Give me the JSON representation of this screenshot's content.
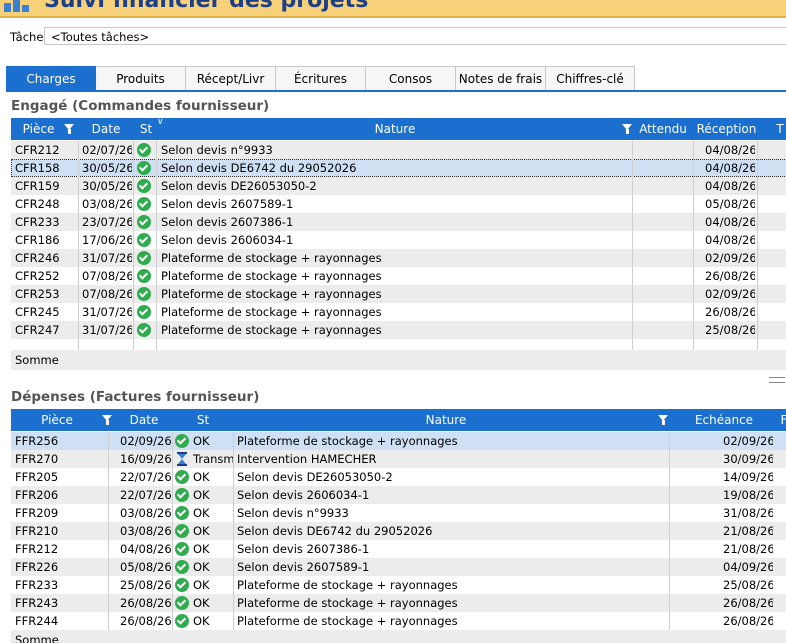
{
  "window": {
    "title": "Suivi financier des projets"
  },
  "filter": {
    "label": "Tâche",
    "value": "<Toutes tâches>"
  },
  "tabs": [
    "Charges",
    "Produits",
    "Récept/Livr",
    "Écritures",
    "Consos",
    "Notes de frais",
    "Chiffres-clé"
  ],
  "active_tab": "Charges",
  "colors": {
    "accent": "#1a6fcf",
    "title_bar": "#f7d179",
    "ok_icon": "#2eac4e",
    "selected_row": "#cfe0f5"
  },
  "engage": {
    "title": "Engagé (Commandes fournisseur)",
    "columns": {
      "piece": "Pièce",
      "date": "Date",
      "st": "St",
      "nature": "Nature",
      "attendu": "Attendu",
      "reception": "Réception",
      "extra": "T"
    },
    "rows": [
      {
        "piece": "CFR212",
        "date": "02/07/26",
        "status": "ok",
        "nature": "Selon devis n°9933",
        "attendu": "",
        "reception": "04/08/26"
      },
      {
        "piece": "CFR158",
        "date": "30/05/26",
        "status": "ok",
        "nature": "Selon devis DE6742 du 29052026",
        "attendu": "",
        "reception": "04/08/26"
      },
      {
        "piece": "CFR159",
        "date": "30/05/26",
        "status": "ok",
        "nature": "Selon devis DE26053050-2",
        "attendu": "",
        "reception": "04/08/26"
      },
      {
        "piece": "CFR248",
        "date": "03/08/26",
        "status": "ok",
        "nature": "Selon devis 2607589-1",
        "attendu": "",
        "reception": "05/08/26"
      },
      {
        "piece": "CFR233",
        "date": "23/07/26",
        "status": "ok",
        "nature": "Selon devis 2607386-1",
        "attendu": "",
        "reception": "04/08/26"
      },
      {
        "piece": "CFR186",
        "date": "17/06/26",
        "status": "ok",
        "nature": "Selon devis 2606034-1",
        "attendu": "",
        "reception": "04/08/26"
      },
      {
        "piece": "CFR246",
        "date": "31/07/26",
        "status": "ok",
        "nature": "Plateforme de stockage + rayonnages",
        "attendu": "",
        "reception": "02/09/26"
      },
      {
        "piece": "CFR252",
        "date": "07/08/26",
        "status": "ok",
        "nature": "Plateforme de stockage + rayonnages",
        "attendu": "",
        "reception": "26/08/26"
      },
      {
        "piece": "CFR253",
        "date": "07/08/26",
        "status": "ok",
        "nature": "Plateforme de stockage + rayonnages",
        "attendu": "",
        "reception": "02/09/26"
      },
      {
        "piece": "CFR245",
        "date": "31/07/26",
        "status": "ok",
        "nature": "Plateforme de stockage + rayonnages",
        "attendu": "",
        "reception": "26/08/26"
      },
      {
        "piece": "CFR247",
        "date": "31/07/26",
        "status": "ok",
        "nature": "Plateforme de stockage + rayonnages",
        "attendu": "",
        "reception": "25/08/26"
      }
    ],
    "selected_row_index": 1,
    "sum_label": "Somme"
  },
  "depenses": {
    "title": "Dépenses (Factures  fournisseur)",
    "columns": {
      "piece": "Pièce",
      "date": "Date",
      "st": "St",
      "nature": "Nature",
      "echeance": "Echéance",
      "extra": "F"
    },
    "rows": [
      {
        "piece": "FFR256",
        "date": "02/09/26",
        "status": "ok",
        "status_text": "OK",
        "nature": "Plateforme de stockage + rayonnages",
        "echeance": "02/09/26"
      },
      {
        "piece": "FFR270",
        "date": "16/09/26",
        "status": "pending",
        "status_text": "Transm",
        "nature": "Intervention HAMECHER",
        "echeance": "30/09/26"
      },
      {
        "piece": "FFR205",
        "date": "22/07/26",
        "status": "ok",
        "status_text": "OK",
        "nature": "Selon devis DE26053050-2",
        "echeance": "14/09/26"
      },
      {
        "piece": "FFR206",
        "date": "22/07/26",
        "status": "ok",
        "status_text": "OK",
        "nature": "Selon devis 2606034-1",
        "echeance": "19/08/26"
      },
      {
        "piece": "FFR209",
        "date": "03/08/26",
        "status": "ok",
        "status_text": "OK",
        "nature": "Selon devis n°9933",
        "echeance": "31/08/26"
      },
      {
        "piece": "FFR210",
        "date": "03/08/26",
        "status": "ok",
        "status_text": "OK",
        "nature": "Selon devis DE6742 du 29052026",
        "echeance": "21/08/26"
      },
      {
        "piece": "FFR212",
        "date": "04/08/26",
        "status": "ok",
        "status_text": "OK",
        "nature": "Selon devis 2607386-1",
        "echeance": "21/08/26"
      },
      {
        "piece": "FFR226",
        "date": "05/08/26",
        "status": "ok",
        "status_text": "OK",
        "nature": "Selon devis 2607589-1",
        "echeance": "04/09/26"
      },
      {
        "piece": "FFR233",
        "date": "25/08/26",
        "status": "ok",
        "status_text": "OK",
        "nature": "Plateforme de stockage + rayonnages",
        "echeance": "25/08/26"
      },
      {
        "piece": "FFR243",
        "date": "26/08/26",
        "status": "ok",
        "status_text": "OK",
        "nature": "Plateforme de stockage + rayonnages",
        "echeance": "26/08/26"
      },
      {
        "piece": "FFR244",
        "date": "26/08/26",
        "status": "ok",
        "status_text": "OK",
        "nature": "Plateforme de stockage + rayonnages",
        "echeance": "26/08/26"
      }
    ],
    "selected_row_index": 0,
    "sum_label": "Somme"
  }
}
